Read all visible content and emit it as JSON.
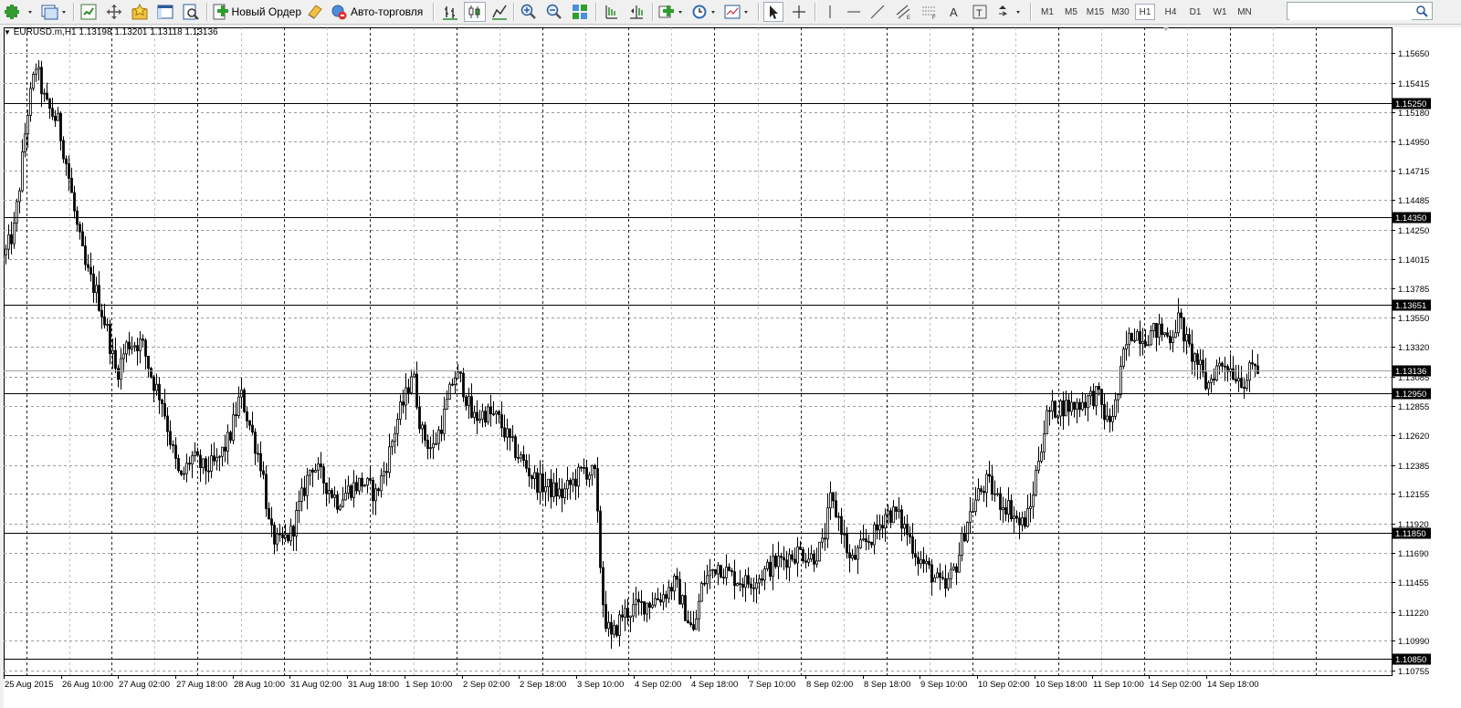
{
  "toolbar": {
    "new_order_label": "Новый Ордер",
    "auto_trading_label": "Авто-торговля",
    "timeframes": [
      "M1",
      "M5",
      "M15",
      "M30",
      "H1",
      "H4",
      "D1",
      "W1",
      "MN"
    ],
    "active_timeframe": "H1",
    "search_value": ""
  },
  "chart": {
    "symbol_label": "EURUSD.m,H1",
    "ohlc_text": "1.13198 1.13201 1.13118 1.13136"
  },
  "chart_data": {
    "type": "candlestick",
    "title": "EURUSD.m,H1",
    "x_tick_labels": [
      "25 Aug 2015",
      "26 Aug 10:00",
      "27 Aug 02:00",
      "27 Aug 18:00",
      "28 Aug 10:00",
      "31 Aug 02:00",
      "31 Aug 18:00",
      "1 Sep 10:00",
      "2 Sep 02:00",
      "2 Sep 18:00",
      "3 Sep 10:00",
      "4 Sep 02:00",
      "4 Sep 18:00",
      "7 Sep 10:00",
      "8 Sep 02:00",
      "8 Sep 18:00",
      "9 Sep 10:00",
      "10 Sep 02:00",
      "10 Sep 18:00",
      "11 Sep 10:00",
      "14 Sep 02:00",
      "14 Sep 18:00"
    ],
    "y_tick_labels": [
      "1.15650",
      "1.15415",
      "1.15180",
      "1.14950",
      "1.14715",
      "1.14485",
      "1.14250",
      "1.14015",
      "1.13785",
      "1.13550",
      "1.13320",
      "1.13085",
      "1.12855",
      "1.12620",
      "1.12385",
      "1.12155",
      "1.11920",
      "1.11690",
      "1.11455",
      "1.11220",
      "1.10990",
      "1.10755"
    ],
    "ylim": [
      1.10755,
      1.1565
    ],
    "grid": true,
    "horizontal_levels": [
      "1.15250",
      "1.14350",
      "1.13651",
      "1.12950",
      "1.11850",
      "1.10850"
    ],
    "current_price": "1.13136",
    "close_path": [
      {
        "x": 0,
        "y": 1.1405
      },
      {
        "x": 10,
        "y": 1.1425
      },
      {
        "x": 16,
        "y": 1.146
      },
      {
        "x": 24,
        "y": 1.1515
      },
      {
        "x": 34,
        "y": 1.1555
      },
      {
        "x": 44,
        "y": 1.1525
      },
      {
        "x": 58,
        "y": 1.151
      },
      {
        "x": 68,
        "y": 1.1475
      },
      {
        "x": 78,
        "y": 1.143
      },
      {
        "x": 88,
        "y": 1.1395
      },
      {
        "x": 100,
        "y": 1.1375
      },
      {
        "x": 112,
        "y": 1.1345
      },
      {
        "x": 122,
        "y": 1.131
      },
      {
        "x": 134,
        "y": 1.1335
      },
      {
        "x": 150,
        "y": 1.1335
      },
      {
        "x": 162,
        "y": 1.1305
      },
      {
        "x": 172,
        "y": 1.129
      },
      {
        "x": 182,
        "y": 1.1255
      },
      {
        "x": 192,
        "y": 1.1225
      },
      {
        "x": 204,
        "y": 1.1245
      },
      {
        "x": 218,
        "y": 1.1235
      },
      {
        "x": 232,
        "y": 1.124
      },
      {
        "x": 246,
        "y": 1.126
      },
      {
        "x": 258,
        "y": 1.1295
      },
      {
        "x": 272,
        "y": 1.126
      },
      {
        "x": 282,
        "y": 1.1235
      },
      {
        "x": 290,
        "y": 1.1185
      },
      {
        "x": 300,
        "y": 1.1175
      },
      {
        "x": 314,
        "y": 1.1185
      },
      {
        "x": 324,
        "y": 1.121
      },
      {
        "x": 336,
        "y": 1.124
      },
      {
        "x": 350,
        "y": 1.1225
      },
      {
        "x": 364,
        "y": 1.121
      },
      {
        "x": 378,
        "y": 1.122
      },
      {
        "x": 392,
        "y": 1.1225
      },
      {
        "x": 406,
        "y": 1.1215
      },
      {
        "x": 418,
        "y": 1.124
      },
      {
        "x": 430,
        "y": 1.1275
      },
      {
        "x": 440,
        "y": 1.1295
      },
      {
        "x": 446,
        "y": 1.1315
      },
      {
        "x": 456,
        "y": 1.1265
      },
      {
        "x": 468,
        "y": 1.125
      },
      {
        "x": 480,
        "y": 1.1275
      },
      {
        "x": 492,
        "y": 1.131
      },
      {
        "x": 500,
        "y": 1.1305
      },
      {
        "x": 512,
        "y": 1.1275
      },
      {
        "x": 526,
        "y": 1.128
      },
      {
        "x": 540,
        "y": 1.1275
      },
      {
        "x": 554,
        "y": 1.1255
      },
      {
        "x": 568,
        "y": 1.124
      },
      {
        "x": 582,
        "y": 1.1225
      },
      {
        "x": 596,
        "y": 1.122
      },
      {
        "x": 610,
        "y": 1.1215
      },
      {
        "x": 622,
        "y": 1.1225
      },
      {
        "x": 634,
        "y": 1.1235
      },
      {
        "x": 646,
        "y": 1.123
      },
      {
        "x": 652,
        "y": 1.116
      },
      {
        "x": 656,
        "y": 1.112
      },
      {
        "x": 664,
        "y": 1.11
      },
      {
        "x": 676,
        "y": 1.112
      },
      {
        "x": 690,
        "y": 1.1125
      },
      {
        "x": 706,
        "y": 1.113
      },
      {
        "x": 720,
        "y": 1.1135
      },
      {
        "x": 734,
        "y": 1.1145
      },
      {
        "x": 746,
        "y": 1.112
      },
      {
        "x": 754,
        "y": 1.1105
      },
      {
        "x": 764,
        "y": 1.1145
      },
      {
        "x": 780,
        "y": 1.116
      },
      {
        "x": 796,
        "y": 1.115
      },
      {
        "x": 812,
        "y": 1.1145
      },
      {
        "x": 826,
        "y": 1.115
      },
      {
        "x": 842,
        "y": 1.116
      },
      {
        "x": 856,
        "y": 1.1165
      },
      {
        "x": 870,
        "y": 1.117
      },
      {
        "x": 884,
        "y": 1.1165
      },
      {
        "x": 896,
        "y": 1.1175
      },
      {
        "x": 904,
        "y": 1.121
      },
      {
        "x": 914,
        "y": 1.1195
      },
      {
        "x": 926,
        "y": 1.116
      },
      {
        "x": 940,
        "y": 1.1175
      },
      {
        "x": 954,
        "y": 1.1185
      },
      {
        "x": 964,
        "y": 1.12
      },
      {
        "x": 976,
        "y": 1.12
      },
      {
        "x": 988,
        "y": 1.1185
      },
      {
        "x": 1000,
        "y": 1.1165
      },
      {
        "x": 1012,
        "y": 1.1155
      },
      {
        "x": 1022,
        "y": 1.1145
      },
      {
        "x": 1030,
        "y": 1.114
      },
      {
        "x": 1042,
        "y": 1.116
      },
      {
        "x": 1054,
        "y": 1.1195
      },
      {
        "x": 1066,
        "y": 1.1215
      },
      {
        "x": 1076,
        "y": 1.1225
      },
      {
        "x": 1088,
        "y": 1.121
      },
      {
        "x": 1100,
        "y": 1.1205
      },
      {
        "x": 1112,
        "y": 1.119
      },
      {
        "x": 1122,
        "y": 1.12
      },
      {
        "x": 1132,
        "y": 1.1245
      },
      {
        "x": 1142,
        "y": 1.128
      },
      {
        "x": 1156,
        "y": 1.1285
      },
      {
        "x": 1170,
        "y": 1.1285
      },
      {
        "x": 1184,
        "y": 1.129
      },
      {
        "x": 1196,
        "y": 1.1295
      },
      {
        "x": 1208,
        "y": 1.127
      },
      {
        "x": 1218,
        "y": 1.129
      },
      {
        "x": 1226,
        "y": 1.133
      },
      {
        "x": 1236,
        "y": 1.1345
      },
      {
        "x": 1248,
        "y": 1.134
      },
      {
        "x": 1262,
        "y": 1.1345
      },
      {
        "x": 1276,
        "y": 1.134
      },
      {
        "x": 1286,
        "y": 1.1355
      },
      {
        "x": 1296,
        "y": 1.133
      },
      {
        "x": 1306,
        "y": 1.132
      },
      {
        "x": 1316,
        "y": 1.13
      },
      {
        "x": 1326,
        "y": 1.1315
      },
      {
        "x": 1336,
        "y": 1.132
      },
      {
        "x": 1348,
        "y": 1.131
      },
      {
        "x": 1358,
        "y": 1.1305
      },
      {
        "x": 1368,
        "y": 1.1318
      },
      {
        "x": 1374,
        "y": 1.13136
      }
    ]
  },
  "colors": {
    "background": "#ffffff",
    "grid": "#9c9c9c",
    "candles": "#000000",
    "level_label_bg": "#000000",
    "level_label_text": "#ffffff",
    "toolbar_bg": "#f0f0f0"
  }
}
